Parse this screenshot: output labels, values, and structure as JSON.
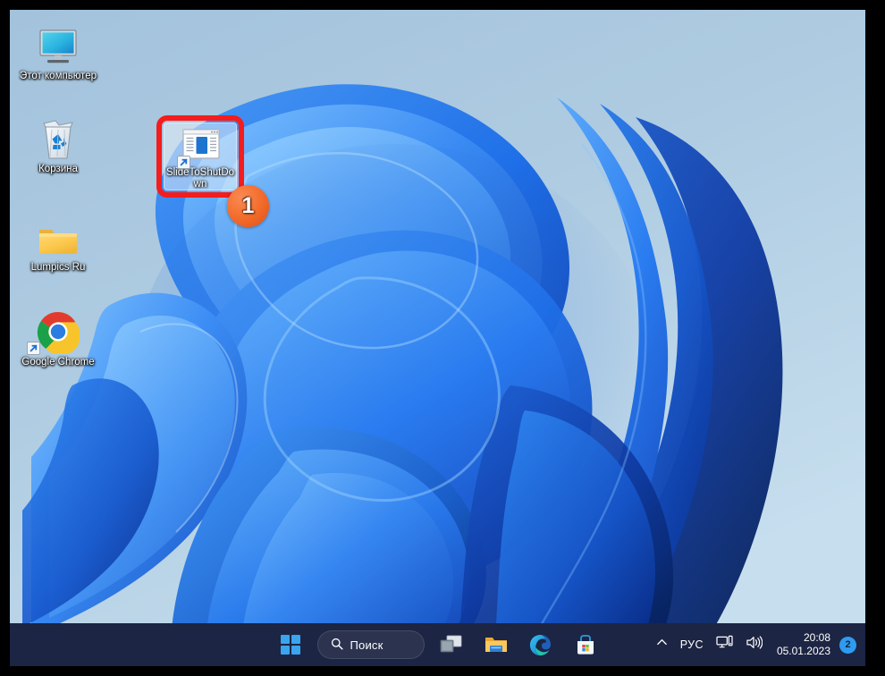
{
  "desktop": {
    "wallpaper_name": "windows-11-bloom-wallpaper",
    "background_color": "#a9c6de",
    "icons": [
      {
        "id": "this-pc",
        "name": "monitor-icon",
        "label": "Этот компьютер",
        "shortcut": false
      },
      {
        "id": "recycle-bin",
        "name": "recycle-bin-icon",
        "label": "Корзина",
        "shortcut": false
      },
      {
        "id": "lumpics-ru",
        "name": "folder-icon",
        "label": "Lumpics Ru",
        "shortcut": false
      },
      {
        "id": "google-chrome",
        "name": "chrome-icon",
        "label": "Google Chrome",
        "shortcut": true
      }
    ],
    "selected_shortcut": {
      "name": "slide-to-shutdown-icon",
      "label": "SlideToShutDown",
      "shortcut": true,
      "highlight_color": "#f41c1c"
    }
  },
  "annotations": {
    "steps": [
      {
        "number": "1",
        "color": "#f4702f",
        "target": "slide-to-shutdown-shortcut"
      }
    ]
  },
  "taskbar": {
    "background_color": "#1c2543",
    "start": {
      "name": "start-button",
      "label": "Пуск"
    },
    "search": {
      "name": "search-box",
      "label": "Поиск",
      "placeholder": "Поиск",
      "icon": "search-icon"
    },
    "pinned": [
      {
        "id": "task-view",
        "name": "task-view-icon",
        "label": "Представление задач"
      },
      {
        "id": "file-explorer",
        "name": "file-explorer-icon",
        "label": "Проводник"
      },
      {
        "id": "microsoft-edge",
        "name": "microsoft-edge-icon",
        "label": "Microsoft Edge"
      },
      {
        "id": "microsoft-store",
        "name": "microsoft-store-icon",
        "label": "Microsoft Store"
      }
    ],
    "tray": {
      "overflow": {
        "name": "chevron-up-icon",
        "label": "Отображать скрытые значки"
      },
      "language": {
        "name": "language-indicator",
        "label": "РУС"
      },
      "network": {
        "name": "network-icon",
        "label": "Сеть"
      },
      "volume": {
        "name": "volume-icon",
        "label": "Громкость"
      },
      "clock": {
        "time": "20:08",
        "date": "05.01.2023"
      },
      "notifications": {
        "name": "notification-badge",
        "count": "2",
        "color": "#2e9bf0"
      }
    }
  }
}
